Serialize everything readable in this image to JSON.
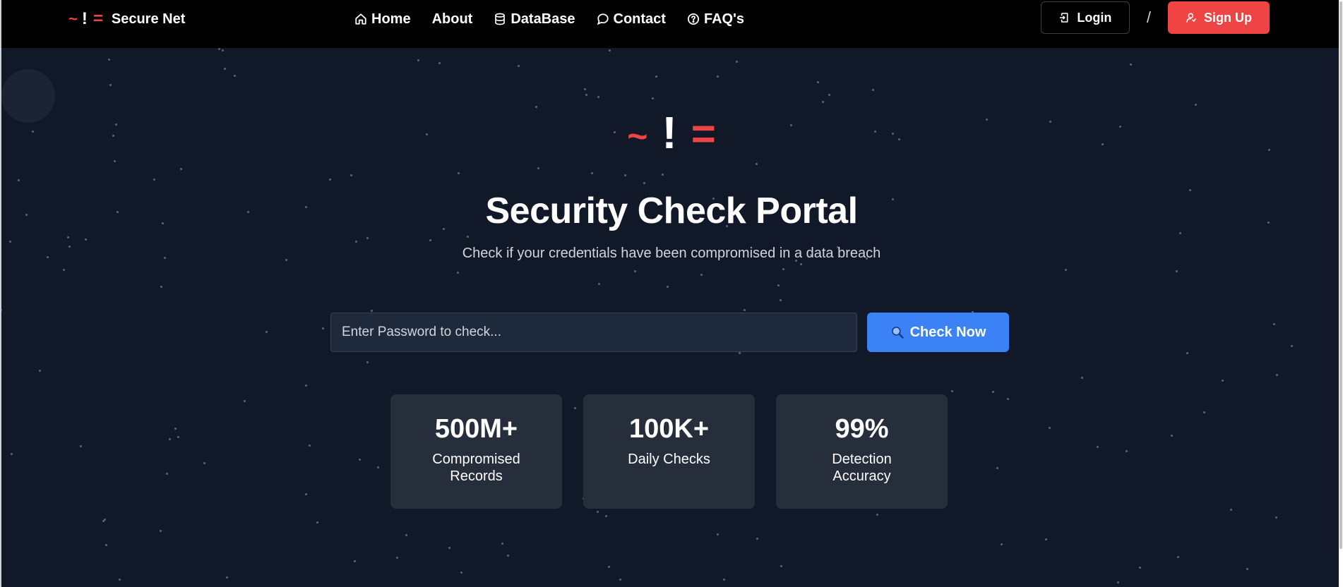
{
  "brand": {
    "logo_tilde": "~",
    "logo_bang": "!",
    "logo_eq": "=",
    "name": "Secure Net"
  },
  "nav": {
    "items": [
      {
        "label": "Home",
        "icon": "home-icon"
      },
      {
        "label": "About",
        "icon": ""
      },
      {
        "label": "DataBase",
        "icon": "database-icon"
      },
      {
        "label": "Contact",
        "icon": "chat-bubble-icon"
      },
      {
        "label": "FAQ's",
        "icon": "question-circle-icon"
      }
    ]
  },
  "auth": {
    "login_label": "Login",
    "separator": "/",
    "signup_label": "Sign Up"
  },
  "hero": {
    "logo_tilde": "~",
    "logo_bang": "!",
    "logo_eq": "=",
    "title": "Security Check Portal",
    "subtitle": "Check if your credentials have been compromised in a data breach"
  },
  "search": {
    "placeholder": "Enter Password to check...",
    "value": "",
    "button_label": "Check Now"
  },
  "stats": [
    {
      "value": "500M+",
      "label": "Compromised Records"
    },
    {
      "value": "100K+",
      "label": "Daily Checks"
    },
    {
      "value": "99%",
      "label": "Detection Accuracy"
    }
  ],
  "colors": {
    "accent_red": "#ef4444",
    "accent_blue": "#3b82f6",
    "background": "#111827",
    "navbar": "#000000"
  }
}
